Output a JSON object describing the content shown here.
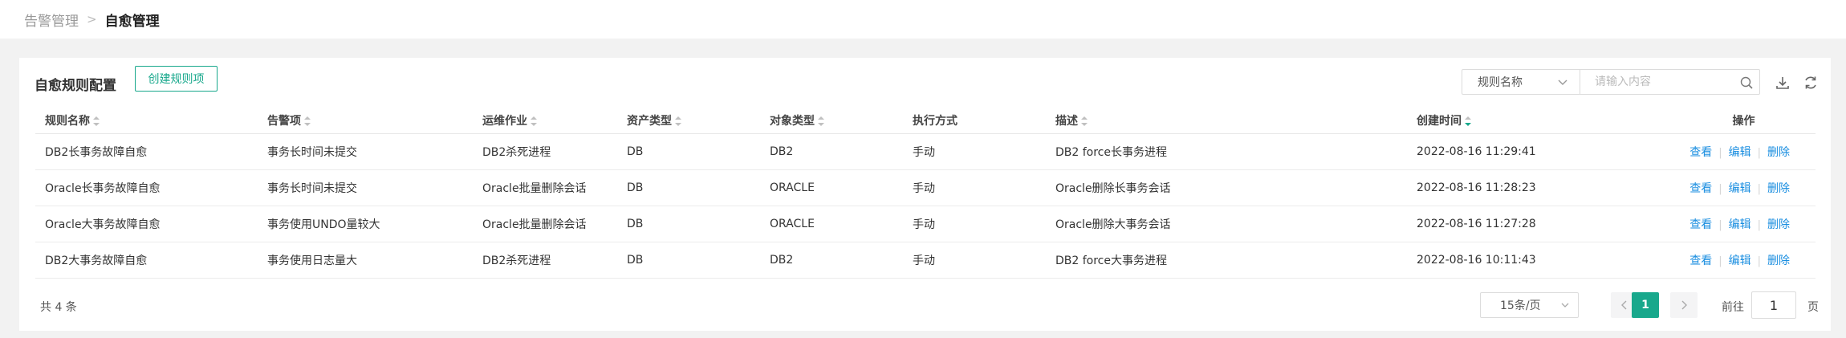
{
  "breadcrumb": {
    "parent": "告警管理",
    "separator": ">",
    "current": "自愈管理"
  },
  "panel": {
    "title": "自愈规则配置",
    "create_label": "创建规则项",
    "search_field": "规则名称",
    "search_placeholder": "请输入内容"
  },
  "table": {
    "columns": [
      "规则名称",
      "告警项",
      "运维作业",
      "资产类型",
      "对象类型",
      "执行方式",
      "描述",
      "创建时间",
      "操作"
    ],
    "rows": [
      [
        "DB2长事务故障自愈",
        "事务长时间未提交",
        "DB2杀死进程",
        "DB",
        "DB2",
        "手动",
        "DB2 force长事务进程",
        "2022-08-16 11:29:41"
      ],
      [
        "Oracle长事务故障自愈",
        "事务长时间未提交",
        "Oracle批量删除会话",
        "DB",
        "ORACLE",
        "手动",
        "Oracle删除长事务会话",
        "2022-08-16 11:28:23"
      ],
      [
        "Oracle大事务故障自愈",
        "事务使用UNDO量较大",
        "Oracle批量删除会话",
        "DB",
        "ORACLE",
        "手动",
        "Oracle删除大事务会话",
        "2022-08-16 11:27:28"
      ],
      [
        "DB2大事务故障自愈",
        "事务使用日志量大",
        "DB2杀死进程",
        "DB",
        "DB2",
        "手动",
        "DB2 force大事务进程",
        "2022-08-16 10:11:43"
      ]
    ],
    "actions": {
      "view": "查看",
      "edit": "编辑",
      "delete": "删除"
    }
  },
  "pagination": {
    "total_text": "共 4 条",
    "page_size": "15条/页",
    "current_page": "1",
    "goto_prefix": "前往",
    "goto_value": "1",
    "goto_suffix": "页"
  },
  "colors": {
    "accent": "#18a88c",
    "link": "#1a8ee0"
  }
}
